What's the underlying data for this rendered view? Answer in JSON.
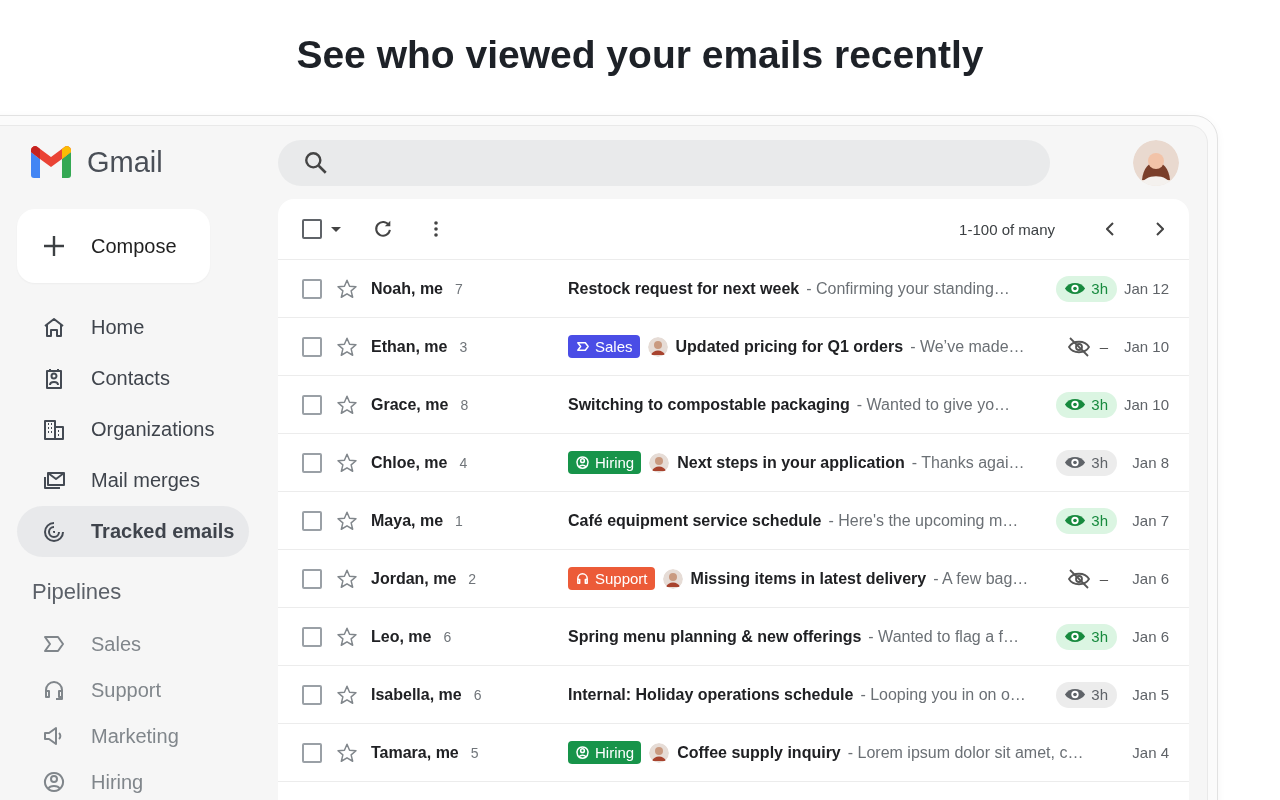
{
  "headline": "See who viewed your emails recently",
  "app": {
    "name": "Gmail"
  },
  "compose": {
    "label": "Compose"
  },
  "nav": [
    {
      "label": "Home",
      "selected": false
    },
    {
      "label": "Contacts",
      "selected": false
    },
    {
      "label": "Organizations",
      "selected": false
    },
    {
      "label": "Mail merges",
      "selected": false
    },
    {
      "label": "Tracked emails",
      "selected": true
    }
  ],
  "pipelines": {
    "title": "Pipelines",
    "items": [
      {
        "label": "Sales"
      },
      {
        "label": "Support"
      },
      {
        "label": "Marketing"
      },
      {
        "label": "Hiring"
      }
    ]
  },
  "toolbar": {
    "select_all_checked": false,
    "range": "1-100 of many"
  },
  "emails": [
    {
      "checked": false,
      "starred": false,
      "sender": "Noah, me",
      "count": "7",
      "subject": "Restock request for next week",
      "preview": "- Confirming your standing…",
      "tracking": {
        "kind": "viewed",
        "text": "3h"
      },
      "date": "Jan 12"
    },
    {
      "checked": false,
      "starred": false,
      "sender": "Ethan, me",
      "count": "3",
      "tag": {
        "label": "Sales",
        "kind": "sales",
        "color": "#4a4de6"
      },
      "avatar": true,
      "subject": "Updated pricing for Q1 orders",
      "preview": "- We’ve made…",
      "tracking": {
        "kind": "not_viewed",
        "text": "–"
      },
      "date": "Jan 10"
    },
    {
      "checked": false,
      "starred": false,
      "sender": "Grace, me",
      "count": "8",
      "subject": "Switching to compostable packaging",
      "preview": "- Wanted to give yo…",
      "tracking": {
        "kind": "viewed",
        "text": "3h"
      },
      "date": "Jan 10"
    },
    {
      "checked": false,
      "starred": false,
      "sender": "Chloe, me",
      "count": "4",
      "tag": {
        "label": "Hiring",
        "kind": "hiring",
        "color": "#17944a"
      },
      "avatar": true,
      "subject": "Next steps in your application",
      "preview": "- Thanks agai…",
      "tracking": {
        "kind": "viewed_earlier",
        "text": "3h"
      },
      "date": "Jan 8"
    },
    {
      "checked": false,
      "starred": false,
      "sender": "Maya, me",
      "count": "1",
      "subject": "Café equipment service schedule",
      "preview": "- Here's the upcoming m…",
      "tracking": {
        "kind": "viewed",
        "text": "3h"
      },
      "date": "Jan 7"
    },
    {
      "checked": false,
      "starred": false,
      "sender": "Jordan, me",
      "count": "2",
      "tag": {
        "label": "Support",
        "kind": "support",
        "color": "#ec5b38"
      },
      "avatar": true,
      "subject": "Missing items in latest delivery",
      "preview": "- A few bag…",
      "tracking": {
        "kind": "not_viewed",
        "text": "–"
      },
      "date": "Jan 6"
    },
    {
      "checked": false,
      "starred": false,
      "sender": "Leo, me",
      "count": "6",
      "subject": "Spring menu planning & new offerings",
      "preview": "- Wanted to flag a f…",
      "tracking": {
        "kind": "viewed",
        "text": "3h"
      },
      "date": "Jan 6"
    },
    {
      "checked": false,
      "starred": false,
      "sender": "Isabella, me",
      "count": "6",
      "subject": "Internal: Holiday operations schedule",
      "preview": "- Looping you in on o…",
      "tracking": {
        "kind": "viewed_earlier",
        "text": "3h"
      },
      "date": "Jan 5"
    },
    {
      "checked": false,
      "starred": false,
      "sender": "Tamara, me",
      "count": "5",
      "tag": {
        "label": "Hiring",
        "kind": "hiring",
        "color": "#17944a"
      },
      "avatar": true,
      "subject": "Coffee supply inquiry",
      "preview": "- Lorem ipsum dolor sit amet, c…",
      "date": "Jan 4"
    }
  ]
}
